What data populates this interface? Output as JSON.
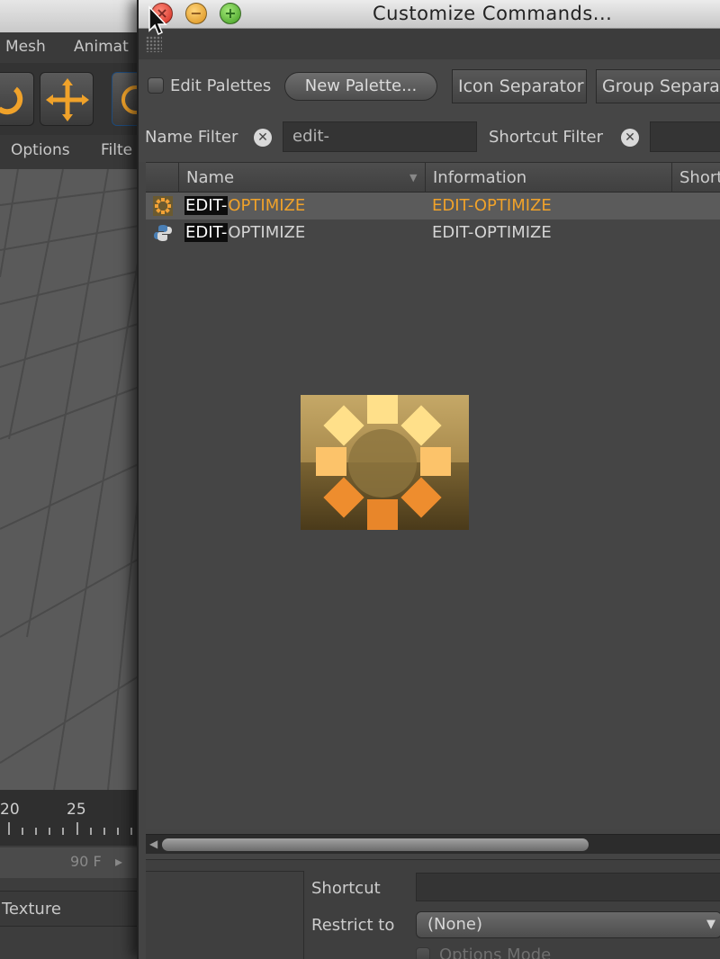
{
  "background_app": {
    "menu": [
      "Mesh",
      "Animat"
    ],
    "subbar": [
      "Options",
      "Filte"
    ],
    "timeline_ticks": [
      "20",
      "25"
    ],
    "frames_value": "90 F",
    "texture_label": "Texture"
  },
  "dialog": {
    "title": "Customize Commands...",
    "toolbar": {
      "edit_palettes_label": "Edit Palettes",
      "new_palette_button": "New Palette...",
      "icon_separator_button": "Icon Separator",
      "group_separator_button": "Group Separat"
    },
    "filters": {
      "name_filter_label": "Name Filter",
      "name_filter_value": "edit-",
      "shortcut_filter_label": "Shortcut Filter",
      "shortcut_filter_value": ""
    },
    "table": {
      "columns": [
        "Name",
        "Information",
        "Short"
      ],
      "rows": [
        {
          "name_match": "EDIT-",
          "name_rest": "OPTIMIZE",
          "information": "EDIT-OPTIMIZE",
          "icon": "optimize-icon",
          "selected": true
        },
        {
          "name_match": "EDIT-",
          "name_rest": "OPTIMIZE",
          "information": "EDIT-OPTIMIZE",
          "icon": "python-icon",
          "selected": false
        }
      ]
    },
    "bottom": {
      "shortcut_label": "Shortcut",
      "shortcut_value": "",
      "restrict_to_label": "Restrict to",
      "restrict_to_value": "(None)",
      "options_mode_label": "Options Mode"
    }
  },
  "colors": {
    "accent_orange": "#f0a22a",
    "panel_bg": "#444444",
    "selection_bg": "#5b5b5b"
  }
}
